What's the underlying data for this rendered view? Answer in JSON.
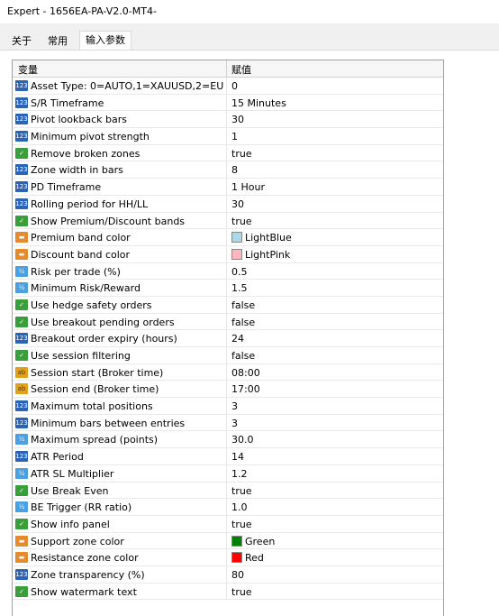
{
  "window": {
    "title": "Expert - 1656EA-PA-V2.0-MT4-"
  },
  "tabs": [
    {
      "label": "关于",
      "active": false
    },
    {
      "label": "常用",
      "active": false
    },
    {
      "label": "输入参数",
      "active": true
    }
  ],
  "table": {
    "headers": {
      "variable": "变量",
      "value": "赋值"
    },
    "rows": [
      {
        "name": "Asset Type: 0=AUTO,1=XAUUSD,2=EUR...",
        "value": "0",
        "type": "int",
        "icon": "int-icon"
      },
      {
        "name": "S/R Timeframe",
        "value": "15 Minutes",
        "type": "int",
        "icon": "int-icon"
      },
      {
        "name": "Pivot lookback bars",
        "value": "30",
        "type": "int",
        "icon": "int-icon"
      },
      {
        "name": "Minimum pivot strength",
        "value": "1",
        "type": "int",
        "icon": "int-icon"
      },
      {
        "name": "Remove broken zones",
        "value": "true",
        "type": "bool",
        "icon": "bool-icon"
      },
      {
        "name": "Zone width in bars",
        "value": "8",
        "type": "int",
        "icon": "int-icon"
      },
      {
        "name": "PD Timeframe",
        "value": "1 Hour",
        "type": "int",
        "icon": "int-icon"
      },
      {
        "name": "Rolling period for HH/LL",
        "value": "30",
        "type": "int",
        "icon": "int-icon"
      },
      {
        "name": "Show Premium/Discount bands",
        "value": "true",
        "type": "bool",
        "icon": "bool-icon"
      },
      {
        "name": "Premium band color",
        "value": "LightBlue",
        "type": "clr",
        "icon": "color-icon",
        "swatch": "#add8e6"
      },
      {
        "name": "Discount band color",
        "value": "LightPink",
        "type": "clr",
        "icon": "color-icon",
        "swatch": "#ffb6c1"
      },
      {
        "name": "Risk per trade (%)",
        "value": "0.5",
        "type": "dbl",
        "icon": "double-icon"
      },
      {
        "name": "Minimum Risk/Reward",
        "value": "1.5",
        "type": "dbl",
        "icon": "double-icon"
      },
      {
        "name": "Use hedge safety orders",
        "value": "false",
        "type": "bool",
        "icon": "bool-icon"
      },
      {
        "name": "Use breakout pending orders",
        "value": "false",
        "type": "bool",
        "icon": "bool-icon"
      },
      {
        "name": "Breakout order expiry (hours)",
        "value": "24",
        "type": "int",
        "icon": "int-icon"
      },
      {
        "name": "Use session filtering",
        "value": "false",
        "type": "bool",
        "icon": "bool-icon"
      },
      {
        "name": "Session start (Broker time)",
        "value": "08:00",
        "type": "str",
        "icon": "string-icon"
      },
      {
        "name": "Session end (Broker time)",
        "value": "17:00",
        "type": "str",
        "icon": "string-icon"
      },
      {
        "name": "Maximum total positions",
        "value": "3",
        "type": "int",
        "icon": "int-icon"
      },
      {
        "name": "Minimum bars between entries",
        "value": "3",
        "type": "int",
        "icon": "int-icon"
      },
      {
        "name": "Maximum spread (points)",
        "value": "30.0",
        "type": "dbl",
        "icon": "double-icon"
      },
      {
        "name": "ATR Period",
        "value": "14",
        "type": "int",
        "icon": "int-icon"
      },
      {
        "name": "ATR SL Multiplier",
        "value": "1.2",
        "type": "dbl",
        "icon": "double-icon"
      },
      {
        "name": "Use Break Even",
        "value": "true",
        "type": "bool",
        "icon": "bool-icon"
      },
      {
        "name": "BE Trigger (RR ratio)",
        "value": "1.0",
        "type": "dbl",
        "icon": "double-icon"
      },
      {
        "name": "Show info panel",
        "value": "true",
        "type": "bool",
        "icon": "bool-icon"
      },
      {
        "name": "Support zone color",
        "value": "Green",
        "type": "clr",
        "icon": "color-icon",
        "swatch": "#008000"
      },
      {
        "name": "Resistance zone color",
        "value": "Red",
        "type": "clr",
        "icon": "color-icon",
        "swatch": "#ff0000"
      },
      {
        "name": "Zone transparency (%)",
        "value": "80",
        "type": "int",
        "icon": "int-icon"
      },
      {
        "name": "Show watermark text",
        "value": "true",
        "type": "bool",
        "icon": "bool-icon"
      }
    ]
  }
}
